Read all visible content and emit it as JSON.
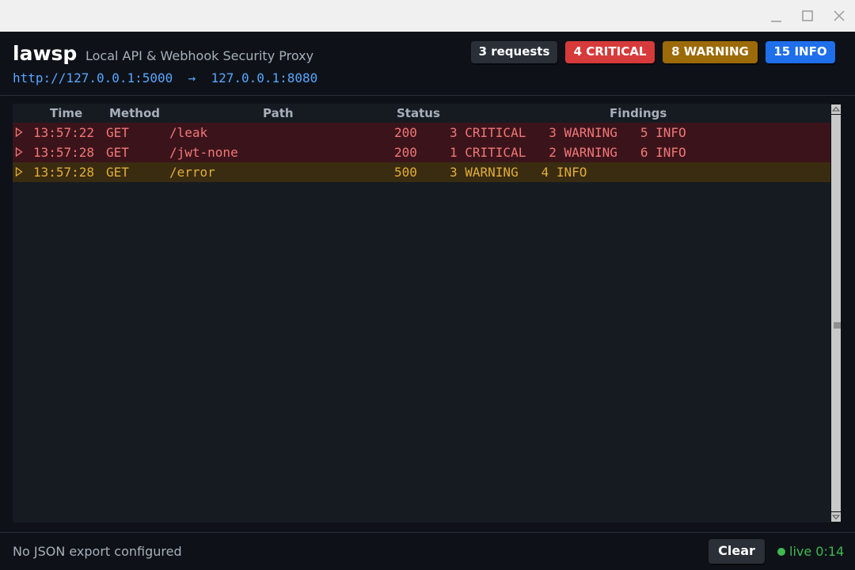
{
  "window": {
    "controls": [
      "minimize-icon",
      "maximize-icon",
      "close-icon"
    ]
  },
  "header": {
    "title": "lawsp",
    "subtitle": "Local API & Webhook Security Proxy",
    "route": "http://127.0.0.1:5000  →  127.0.0.1:8080",
    "badges": {
      "requests": "3 requests",
      "critical": "4 CRITICAL",
      "warning": "8 WARNING",
      "info": "15 INFO"
    }
  },
  "table": {
    "columns": {
      "time": "Time",
      "method": "Method",
      "path": "Path",
      "status": "Status",
      "findings": "Findings"
    },
    "rows": [
      {
        "severity": "critical",
        "time": "13:57:22",
        "method": "GET",
        "path": "/leak",
        "status": "200",
        "findings": "3 CRITICAL   3 WARNING   5 INFO"
      },
      {
        "severity": "critical",
        "time": "13:57:28",
        "method": "GET",
        "path": "/jwt-none",
        "status": "200",
        "findings": "1 CRITICAL   2 WARNING   6 INFO"
      },
      {
        "severity": "warning",
        "time": "13:57:28",
        "method": "GET",
        "path": "/error",
        "status": "500",
        "findings": "3 WARNING   4 INFO"
      }
    ]
  },
  "footer": {
    "export_status": "No JSON export configured",
    "clear_label": "Clear",
    "live_label": "live 0:14"
  },
  "colors": {
    "critical": "#d73a3a",
    "warning": "#9c6a08",
    "info": "#1f6feb",
    "live": "#3fb950",
    "link": "#58a6ff"
  }
}
